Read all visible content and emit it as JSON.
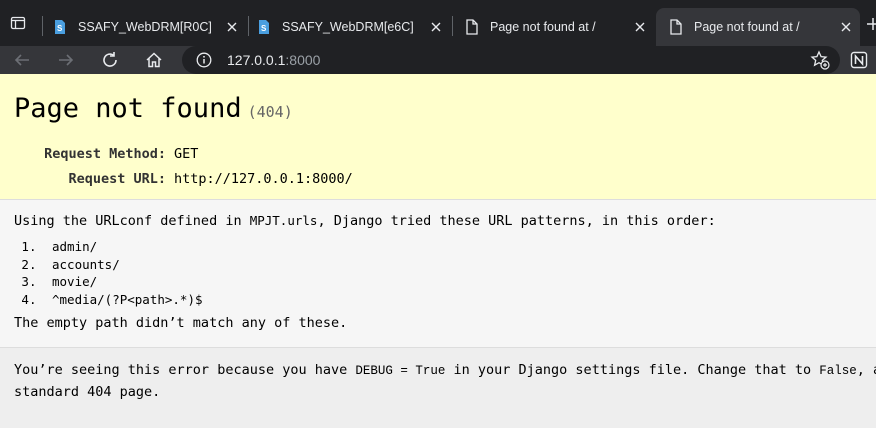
{
  "tabs": [
    {
      "title": "SSAFY_WebDRM[R0C]",
      "favicon": "ssafy-favicon",
      "active": false
    },
    {
      "title": "SSAFY_WebDRM[e6C]",
      "favicon": "ssafy-favicon",
      "active": false
    },
    {
      "title": "Page not found at /",
      "favicon": "document-icon",
      "active": false
    },
    {
      "title": "Page not found at /",
      "favicon": "document-icon",
      "active": true
    }
  ],
  "address_bar": {
    "host": "127.0.0.1",
    "port": ":8000"
  },
  "colors": {
    "tabbar_bg": "#202124",
    "toolbar_bg": "#35363a",
    "summary_bg": "#ffffcc",
    "favicon_blue": "#4a9fe0"
  },
  "summary": {
    "heading": "Page not found",
    "code": "(404)",
    "meta": [
      {
        "label": "Request Method:",
        "value": "GET"
      },
      {
        "label": "Request URL:",
        "value": "http://127.0.0.1:8000/"
      }
    ]
  },
  "info": {
    "intro_before": "Using the URLconf defined in ",
    "urlconf": "MPJT.urls",
    "intro_after": ", Django tried these URL patterns, in this order:",
    "patterns": [
      "admin/",
      "accounts/",
      "movie/",
      "^media/(?P<path>.*)$"
    ],
    "outro": "The empty path didn’t match any of these."
  },
  "explanation": {
    "part1": "You’re seeing this error because you have ",
    "debug_code": "DEBUG = True",
    "part2": " in your Django settings file. Change that to ",
    "false_code": "False",
    "part3": ", and D",
    "line2": "standard 404 page."
  }
}
